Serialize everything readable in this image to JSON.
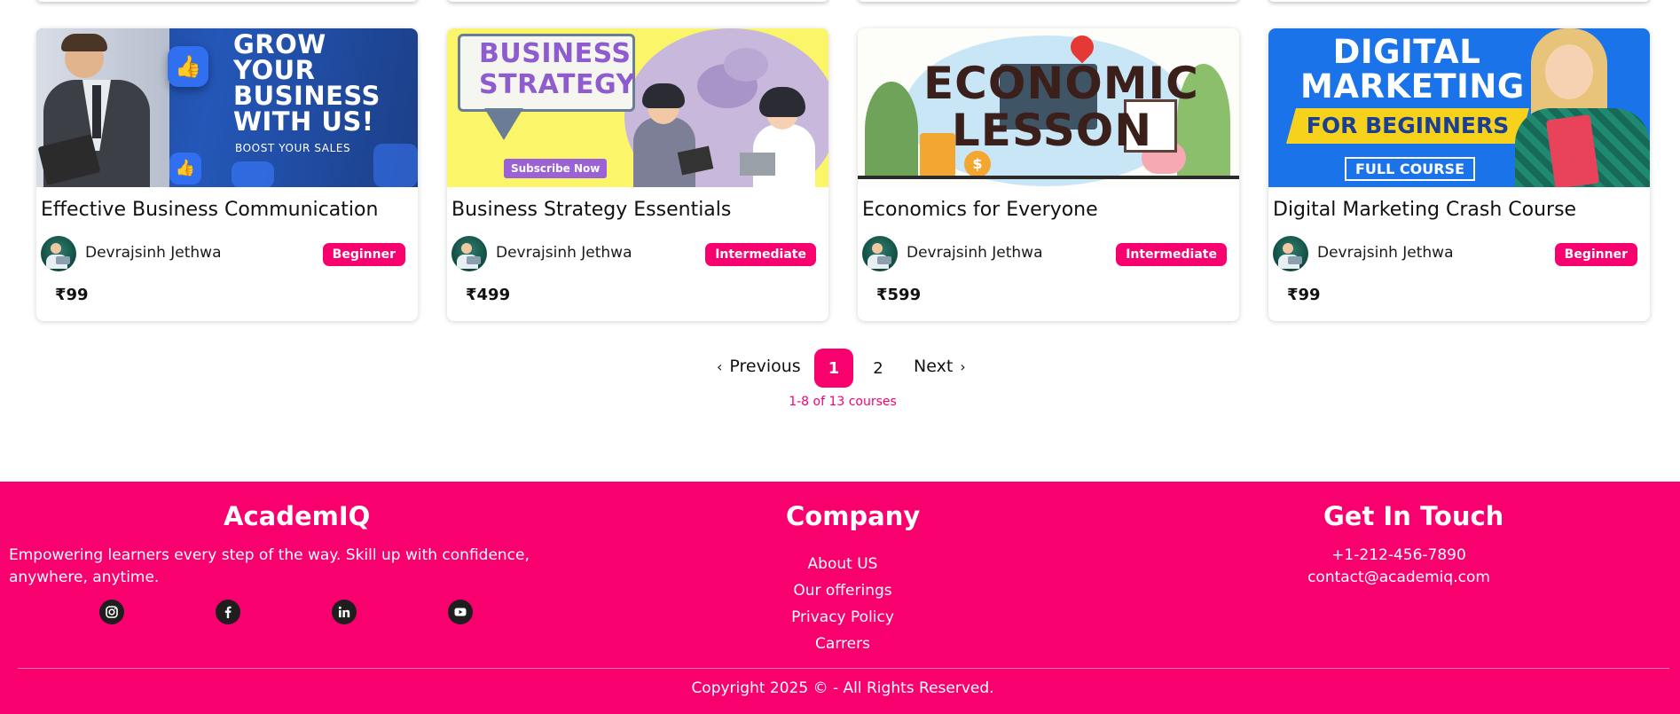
{
  "courses": [
    {
      "thumb_text": [
        "GROW",
        "YOUR",
        "BUSINESS",
        "WITH US!"
      ],
      "thumb_sub": "BOOST YOUR SALES",
      "title": "Effective Business Communication",
      "author": "Devrajsinh Jethwa",
      "level": "Beginner",
      "price": "₹99"
    },
    {
      "thumb_text": [
        "BUSINESS",
        "STRATEGY"
      ],
      "thumb_sub": "Subscribe Now",
      "title": "Business Strategy Essentials",
      "author": "Devrajsinh Jethwa",
      "level": "Intermediate",
      "price": "₹499"
    },
    {
      "thumb_text": [
        "ECONOMIC",
        "LESSON"
      ],
      "title": "Economics for Everyone",
      "author": "Devrajsinh Jethwa",
      "level": "Intermediate",
      "price": "₹599"
    },
    {
      "thumb_text": [
        "DIGITAL",
        "MARKETING"
      ],
      "thumb_sub": "FOR BEGINNERS",
      "thumb_sub2": "FULL COURSE",
      "title": "Digital Marketing Crash Course",
      "author": "Devrajsinh Jethwa",
      "level": "Beginner",
      "price": "₹99"
    }
  ],
  "pagination": {
    "prev_label": "Previous",
    "pages": [
      "1",
      "2"
    ],
    "current_page": "1",
    "next_label": "Next",
    "summary": "1-8 of 13 courses"
  },
  "footer": {
    "brand": {
      "title": "AcademIQ",
      "description": "Empowering learners every step of the way. Skill up with confidence, anywhere, anytime.",
      "socials": [
        "instagram-icon",
        "facebook-icon",
        "linkedin-icon",
        "youtube-icon"
      ]
    },
    "company": {
      "title": "Company",
      "links": [
        "About US",
        "Our offerings",
        "Privacy Policy",
        "Carrers"
      ]
    },
    "contact": {
      "title": "Get In Touch",
      "phone": "+1-212-456-7890",
      "email": "contact@academiq.com"
    },
    "copyright": "Copyright 2025 © - All Rights Reserved."
  },
  "colors": {
    "accent": "#f8006e",
    "text": "#111111",
    "social_bg": "#1e1e1e"
  }
}
